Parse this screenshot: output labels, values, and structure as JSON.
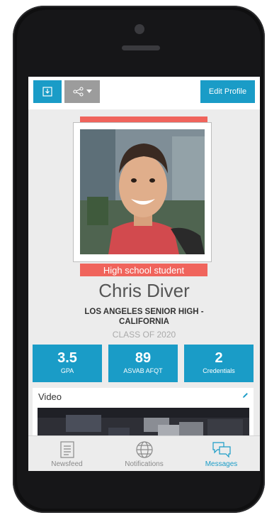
{
  "toolbar": {
    "download_icon": "download-icon",
    "share_icon": "share-icon",
    "edit_label": "Edit Profile"
  },
  "profile": {
    "status": "High school student",
    "name": "Chris Diver",
    "school": "LOS ANGELES SENIOR HIGH - CALIFORNIA",
    "class_of": "CLASS OF 2020"
  },
  "stats": [
    {
      "value": "3.5",
      "label": "GPA"
    },
    {
      "value": "89",
      "label": "ASVAB AFQT"
    },
    {
      "value": "2",
      "label": "Credentials"
    }
  ],
  "video": {
    "title": "Video"
  },
  "tabs": [
    {
      "label": "Newsfeed",
      "icon": "newsfeed-icon"
    },
    {
      "label": "Notifications",
      "icon": "globe-icon"
    },
    {
      "label": "Messages",
      "icon": "messages-icon"
    }
  ],
  "colors": {
    "accent": "#1a9cc7",
    "badge": "#f0645c",
    "share": "#9c9c9c"
  }
}
